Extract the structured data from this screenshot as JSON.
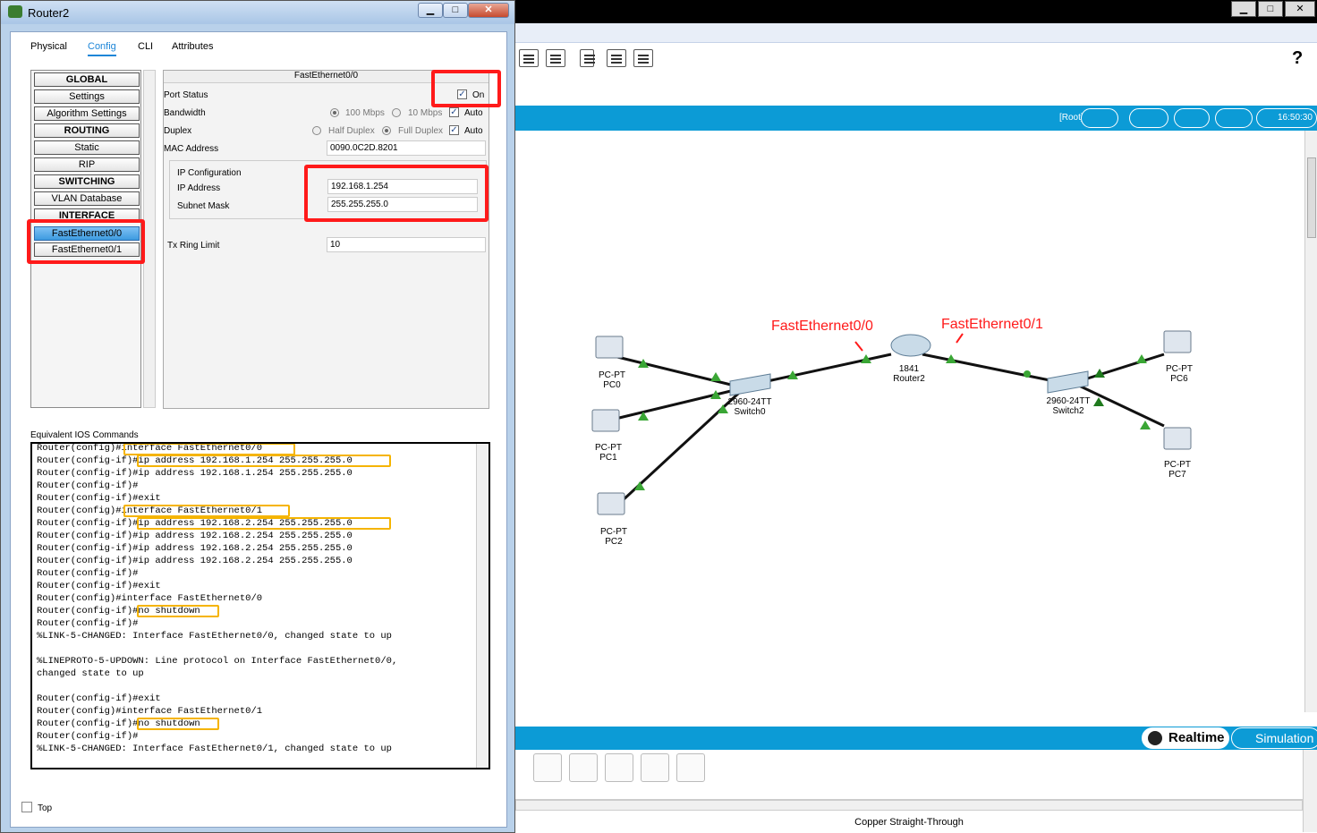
{
  "dialog": {
    "title": "Router2",
    "tabs": [
      "Physical",
      "Config",
      "CLI",
      "Attributes"
    ],
    "active_tab": "Config",
    "left_list": [
      {
        "label": "GLOBAL",
        "header": true
      },
      {
        "label": "Settings"
      },
      {
        "label": "Algorithm Settings"
      },
      {
        "label": "ROUTING",
        "header": true
      },
      {
        "label": "Static"
      },
      {
        "label": "RIP"
      },
      {
        "label": "SWITCHING",
        "header": true
      },
      {
        "label": "VLAN Database"
      },
      {
        "label": "INTERFACE",
        "header": true
      },
      {
        "label": "FastEthernet0/0",
        "selected": true
      },
      {
        "label": "FastEthernet0/1"
      }
    ],
    "panel": {
      "title": "FastEthernet0/0",
      "port_status_label": "Port Status",
      "port_status_value": "On",
      "bandwidth_label": "Bandwidth",
      "bw_100": "100 Mbps",
      "bw_10": "10 Mbps",
      "auto": "Auto",
      "duplex_label": "Duplex",
      "half": "Half Duplex",
      "full": "Full Duplex",
      "mac_label": "MAC Address",
      "mac_value": "0090.0C2D.8201",
      "ip_config_label": "IP Configuration",
      "ip_label": "IP Address",
      "ip_value": "192.168.1.254",
      "mask_label": "Subnet Mask",
      "mask_value": "255.255.255.0",
      "tx_label": "Tx Ring Limit",
      "tx_value": "10"
    },
    "ios_label": "Equivalent IOS Commands",
    "console_lines": [
      "Router(config)#interface FastEthernet0/0",
      "Router(config-if)#ip address 192.168.1.254 255.255.255.0",
      "Router(config-if)#ip address 192.168.1.254 255.255.255.0",
      "Router(config-if)#",
      "Router(config-if)#exit",
      "Router(config)#interface FastEthernet0/1",
      "Router(config-if)#ip address 192.168.2.254 255.255.255.0",
      "Router(config-if)#ip address 192.168.2.254 255.255.255.0",
      "Router(config-if)#ip address 192.168.2.254 255.255.255.0",
      "Router(config-if)#ip address 192.168.2.254 255.255.255.0",
      "Router(config-if)#",
      "Router(config-if)#exit",
      "Router(config)#interface FastEthernet0/0",
      "Router(config-if)#no shutdown",
      "Router(config-if)#",
      "%LINK-5-CHANGED: Interface FastEthernet0/0, changed state to up",
      "",
      "%LINEPROTO-5-UPDOWN: Line protocol on Interface FastEthernet0/0,",
      "changed state to up",
      "",
      "Router(config-if)#exit",
      "Router(config)#interface FastEthernet0/1",
      "Router(config-if)#no shutdown",
      "Router(config-if)#",
      "%LINK-5-CHANGED: Interface FastEthernet0/1, changed state to up"
    ],
    "top_label": "Top"
  },
  "app": {
    "root_label": "[Root]",
    "clock": "16:50:30",
    "help": "?",
    "realtime": "Realtime",
    "simulation": "Simulation",
    "status": "Copper Straight-Through",
    "annotations": [
      "FastEthernet0/0",
      "FastEthernet0/1"
    ],
    "devices": {
      "pc0": [
        "PC-PT",
        "PC0"
      ],
      "pc1": [
        "PC-PT",
        "PC1"
      ],
      "pc2": [
        "PC-PT",
        "PC2"
      ],
      "switch0": [
        "2960-24TT",
        "Switch0"
      ],
      "router2": [
        "1841",
        "Router2"
      ],
      "switch2": [
        "2960-24TT",
        "Switch2"
      ],
      "pc6": [
        "PC-PT",
        "PC6"
      ],
      "pc7": [
        "PC-PT",
        "PC7"
      ]
    }
  },
  "colors": {
    "accent": "#0c9bd6",
    "highlight_red": "#ff1a1a",
    "highlight_yellow": "#f5b400",
    "link_green": "#3aa635"
  }
}
